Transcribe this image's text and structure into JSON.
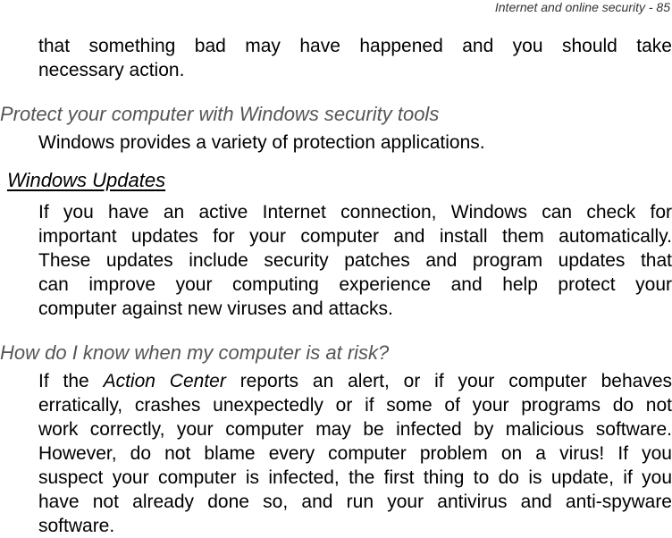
{
  "page_header": {
    "text": "Internet and online security - 85"
  },
  "intro_paragraph": {
    "lines": [
      "that something bad may have happened and you should take",
      "necessary action."
    ]
  },
  "section_protect": {
    "heading": "Protect your computer with Windows security tools",
    "body": "Windows provides a variety of protection applications."
  },
  "section_updates": {
    "heading": "Windows Updates",
    "lines": [
      "If you have an active Internet connection, Windows can check for",
      "important updates for your computer and install them automatically.",
      "These updates include security patches and program updates that",
      "can improve your computing experience and help protect your",
      "computer against new viruses and attacks."
    ]
  },
  "section_risk": {
    "heading": "How do I know when my computer is at risk?",
    "line1_before": "If the",
    "line1_emphasis": "Action Center",
    "line1_after": "reports an alert, or if your computer behaves",
    "lines": [
      "erratically, crashes unexpectedly or if some of your programs do not",
      "work correctly, your computer may be infected by malicious software.",
      "However, do not blame every computer problem on a virus! If you",
      "suspect your computer is infected, the first thing to do is update, if you",
      "have not already done so, and run your antivirus and anti-spyware",
      "software."
    ]
  }
}
